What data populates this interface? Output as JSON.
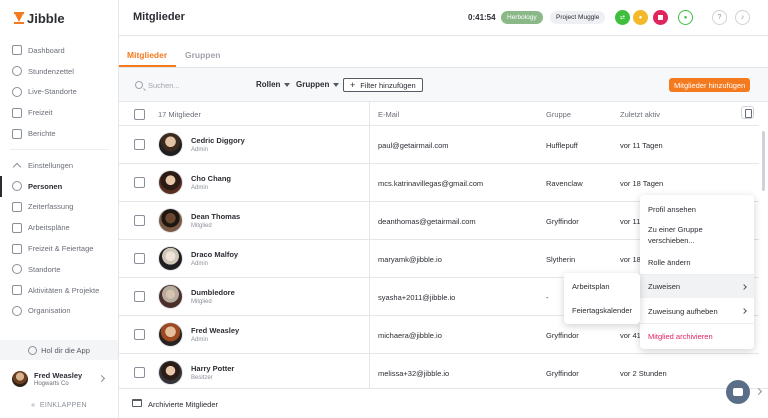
{
  "app": {
    "logo_text": "Jibble",
    "brand_color": "#f47a20"
  },
  "sidebar": {
    "items_top": [
      {
        "label": "Dashboard",
        "icon": "dashboard-icon"
      },
      {
        "label": "Stundenzettel",
        "icon": "clock-icon"
      },
      {
        "label": "Live-Standorte",
        "icon": "location-icon"
      },
      {
        "label": "Freizeit",
        "icon": "suitcase-icon"
      },
      {
        "label": "Berichte",
        "icon": "report-icon"
      }
    ],
    "settings_label": "Einstellungen",
    "items_settings": [
      {
        "label": "Personen",
        "icon": "people-icon",
        "active": true
      },
      {
        "label": "Zeiterfassung",
        "icon": "time-tracking-icon"
      },
      {
        "label": "Arbeitspläne",
        "icon": "schedule-icon"
      },
      {
        "label": "Freizeit & Feiertage",
        "icon": "holiday-icon"
      },
      {
        "label": "Standorte",
        "icon": "location-icon"
      },
      {
        "label": "Aktivitäten & Projekte",
        "icon": "tag-icon"
      },
      {
        "label": "Organisation",
        "icon": "organisation-icon"
      }
    ],
    "app_link": "Hol dir die App",
    "user": {
      "name": "Fred Weasley",
      "org": "Hogwarts Co"
    },
    "collapse_label": "EINKLAPPEN"
  },
  "header": {
    "title": "Mitglieder",
    "timer": "0:41:54",
    "activity_chip": "Herbology",
    "project_chip": "Project Muggle",
    "status_colors": {
      "green": "#3dbf3d",
      "yellow": "#f4b82b",
      "red": "#e0245e"
    }
  },
  "tabs": {
    "members": "Mitglieder",
    "groups": "Gruppen"
  },
  "toolbar": {
    "search_placeholder": "Suchen...",
    "roles_label": "Rollen",
    "groups_label": "Gruppen",
    "filter_label": "Filter hinzufügen",
    "add_label": "Mitglieder hinzufügen"
  },
  "table": {
    "count_label": "17 Mitglieder",
    "col_email": "E-Mail",
    "col_group": "Gruppe",
    "col_active": "Zuletzt aktiv",
    "rows": [
      {
        "name": "Cedric Diggory",
        "role": "Admin",
        "email": "paul@getairmail.com",
        "group": "Hufflepuff",
        "active": "vor 11 Tagen"
      },
      {
        "name": "Cho Chang",
        "role": "Admin",
        "email": "mcs.katrinavillegas@gmail.com",
        "group": "Ravenclaw",
        "active": "vor 18 Tagen"
      },
      {
        "name": "Dean Thomas",
        "role": "Mitglied",
        "email": "deanthomas@getairmail.com",
        "group": "Gryffindor",
        "active": "vor 11"
      },
      {
        "name": "Draco Malfoy",
        "role": "Admin",
        "email": "maryamk@jibble.io",
        "group": "Slytherin",
        "active": "vor 18"
      },
      {
        "name": "Dumbledore",
        "role": "Mitglied",
        "email": "syasha+2011@jibble.io",
        "group": "-",
        "active": ""
      },
      {
        "name": "Fred Weasley",
        "role": "Admin",
        "email": "michaera@jibble.io",
        "group": "Gryffindor",
        "active": "vor 41"
      },
      {
        "name": "Harry Potter",
        "role": "Besitzer",
        "email": "melissa+32@jibble.io",
        "group": "Gryffindor",
        "active": "vor 2 Stunden"
      }
    ]
  },
  "footer": {
    "archive_label": "Archivierte Mitglieder"
  },
  "context_menu": {
    "view_profile": "Profil ansehen",
    "move_group_line1": "Zu einer Gruppe",
    "move_group_line2": "verschieben...",
    "change_role": "Rolle ändern",
    "assign": "Zuweisen",
    "unassign": "Zuweisung aufheben",
    "archive": "Mitglied archivieren"
  },
  "submenu": {
    "schedule": "Arbeitsplan",
    "holiday_calendar": "Feiertagskalender"
  }
}
